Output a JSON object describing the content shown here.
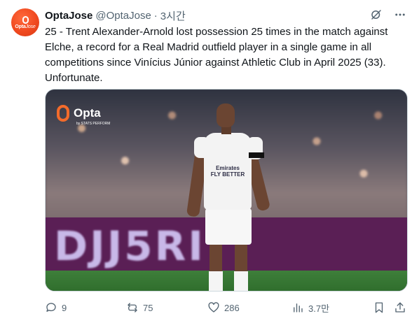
{
  "tweet": {
    "author_name": "OptaJose",
    "author_handle": "@OptaJose",
    "separator": "·",
    "time": "3시간",
    "avatar_brand": "Opta",
    "avatar_brand_suffix": "Jose",
    "text": "25 - Trent Alexander-Arnold lost possession 25 times in the match against Elche, a record for a Real Madrid outfield player in a single game in all competitions since Vinícius Júnior against Athletic Club in April 2025 (33). Unfortunate.",
    "media": {
      "logo_text": "Opta",
      "logo_sub": "by STATS PERFORM",
      "sponsor_line1": "Emirates",
      "sponsor_line2": "FLY BETTER",
      "banner_text": "DJJ5RI"
    },
    "actions": {
      "replies": "9",
      "reposts": "75",
      "likes": "286",
      "views": "3.7만"
    }
  },
  "colors": {
    "text": "#0f1419",
    "secondary": "#536471",
    "border": "#cfd9de",
    "brand": "#f0491f"
  }
}
